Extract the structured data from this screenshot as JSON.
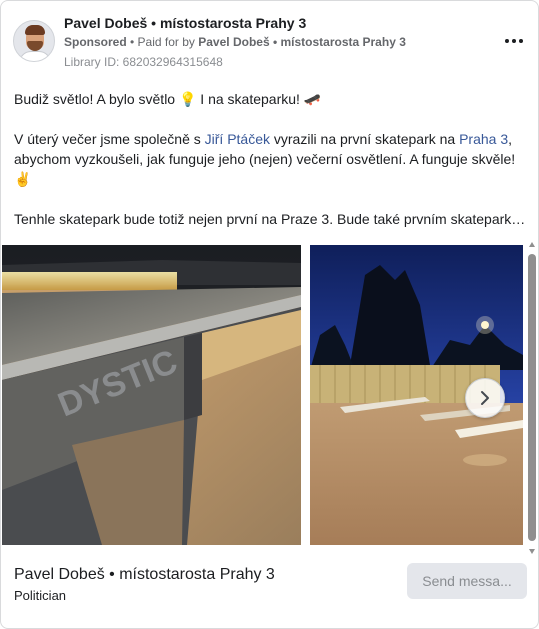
{
  "header": {
    "page_name": "Pavel Dobeš • místostarosta Prahy 3",
    "sponsored_label": "Sponsored",
    "paid_for_prefix": " • Paid for by ",
    "paid_for_name": "Pavel Dobeš • místostarosta Prahy 3",
    "library_id": "Library ID: 682032964315648",
    "more_icon": "more-horizontal-icon"
  },
  "post": {
    "line1": "Budiž světlo! A bylo světlo 💡 I na skateparku! 🛹",
    "p2_part1": "V úterý večer jsme společně s ",
    "p2_link1": "Jiří Ptáček",
    "p2_part2": " vyrazili na první skatepark na ",
    "p2_link2": "Praha 3",
    "p2_part3": ",",
    "p2_line2": "abychom vyzkoušeli, jak funguje jeho (nejen) večerní osvětlení. A funguje skvěle!",
    "p2_emoji": "✌️",
    "p3": "Tenhle skatepark bude totiž nejen první na Praze 3. Bude také prvním skateparkem"
  },
  "carousel": {
    "slide1_text": "DYSTIC",
    "next_icon": "chevron-right-icon"
  },
  "footer": {
    "name": "Pavel Dobeš • místostarosta Prahy 3",
    "category": "Politician",
    "send_button": "Send messa..."
  },
  "colors": {
    "link": "#385898",
    "secondary_text": "#65676b",
    "button_bg": "#e4e6eb"
  }
}
